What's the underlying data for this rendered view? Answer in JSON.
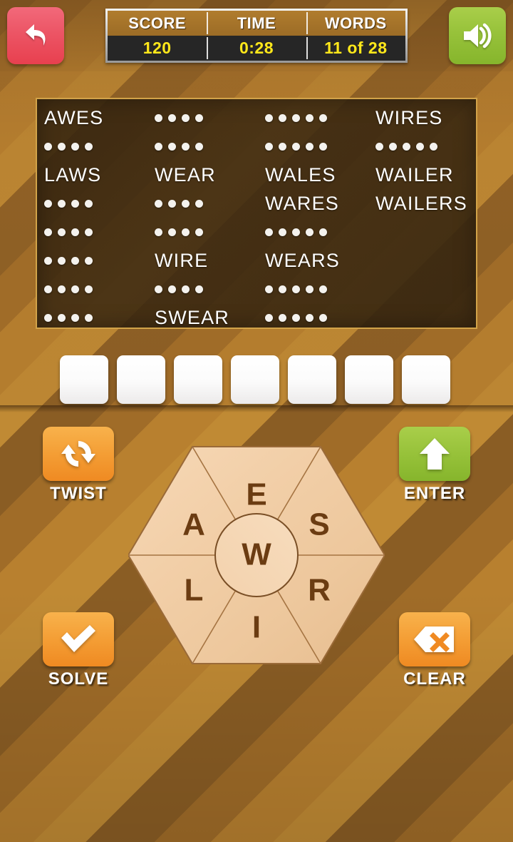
{
  "topbar": {
    "back_icon": "back-arrow-icon",
    "sound_icon": "speaker-on-icon",
    "stats": [
      {
        "label": "SCORE",
        "value": "120"
      },
      {
        "label": "TIME",
        "value": "0:28"
      },
      {
        "label": "WORDS",
        "value": "11 of 28"
      }
    ]
  },
  "word_board": {
    "columns": [
      [
        {
          "type": "word",
          "text": "AWES"
        },
        {
          "type": "dots",
          "count": 4
        },
        {
          "type": "word",
          "text": "LAWS"
        },
        {
          "type": "dots",
          "count": 4
        },
        {
          "type": "dots",
          "count": 4
        },
        {
          "type": "dots",
          "count": 4
        },
        {
          "type": "dots",
          "count": 4
        },
        {
          "type": "dots",
          "count": 4
        }
      ],
      [
        {
          "type": "dots",
          "count": 4
        },
        {
          "type": "dots",
          "count": 4
        },
        {
          "type": "word",
          "text": "WEAR"
        },
        {
          "type": "dots",
          "count": 4
        },
        {
          "type": "dots",
          "count": 4
        },
        {
          "type": "word",
          "text": "WIRE"
        },
        {
          "type": "dots",
          "count": 4
        },
        {
          "type": "word",
          "text": "SWEAR"
        }
      ],
      [
        {
          "type": "dots",
          "count": 5
        },
        {
          "type": "dots",
          "count": 5
        },
        {
          "type": "word",
          "text": "WALES"
        },
        {
          "type": "word",
          "text": "WARES"
        },
        {
          "type": "dots",
          "count": 5
        },
        {
          "type": "word",
          "text": "WEARS"
        },
        {
          "type": "dots",
          "count": 5
        },
        {
          "type": "dots",
          "count": 5
        }
      ],
      [
        {
          "type": "word",
          "text": "WIRES"
        },
        {
          "type": "dots",
          "count": 5
        },
        {
          "type": "word",
          "text": "WAILER"
        },
        {
          "type": "word",
          "text": "WAILERS"
        },
        {
          "type": "empty"
        },
        {
          "type": "empty"
        },
        {
          "type": "empty"
        },
        {
          "type": "empty"
        }
      ]
    ]
  },
  "answer_tiles": [
    "",
    "",
    "",
    "",
    "",
    "",
    ""
  ],
  "wheel": {
    "center_letter": "W",
    "outer_letters": [
      "E",
      "S",
      "R",
      "I",
      "L",
      "A"
    ]
  },
  "actions": [
    {
      "key": "twist",
      "label": "TWIST",
      "icon": "refresh-arrows-icon",
      "color": "#f49e35"
    },
    {
      "key": "enter",
      "label": "ENTER",
      "icon": "up-arrow-icon",
      "color": "#97c23a"
    },
    {
      "key": "solve",
      "label": "SOLVE",
      "icon": "checkmark-icon",
      "color": "#f49e35"
    },
    {
      "key": "clear",
      "label": "CLEAR",
      "icon": "backspace-x-icon",
      "color": "#f49e35"
    }
  ]
}
